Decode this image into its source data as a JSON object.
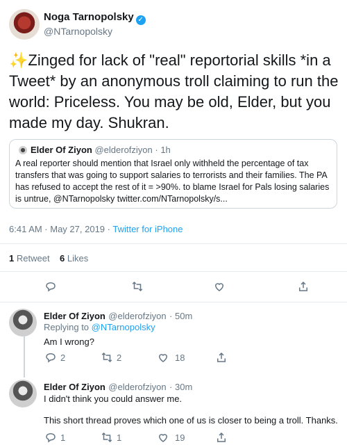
{
  "tweet": {
    "author_name": "Noga Tarnopolsky",
    "author_handle": "@NTarnopolsky",
    "sparkle": "✨",
    "text": "Zinged for lack of \"real\" reportorial skills *in a Tweet* by an anonymous troll claiming to run the world: Priceless. You may be old, Elder, but you made my day. Shukran.",
    "timestamp": "6:41 AM · May 27, 2019 · ",
    "source": "Twitter for iPhone",
    "retweets_count": "1",
    "retweets_label": "Retweet",
    "likes_count": "6",
    "likes_label": "Likes"
  },
  "quoted": {
    "name": "Elder Of Ziyon",
    "handle": "@elderofziyon",
    "time": "· 1h",
    "text": "A real reporter should mention that Israel only withheld the percentage of tax transfers that was going to support salaries to terrorists and their families. The PA has refused to accept the rest of it = >90%. to blame Israel for Pals losing salaries is untrue, @NTarnopolsky twitter.com/NTarnopolsky/s..."
  },
  "replies": [
    {
      "name": "Elder Of Ziyon",
      "handle": "@elderofziyon",
      "time": "· 50m",
      "replying_to_label": "Replying to ",
      "replying_to": "@NTarnopolsky",
      "text": "Am I wrong?",
      "reply_count": "2",
      "retweet_count": "2",
      "like_count": "18"
    },
    {
      "name": "Elder Of Ziyon",
      "handle": "@elderofziyon",
      "time": "· 30m",
      "text_1": "I didn't think you could answer me.",
      "text_2": "This short thread proves which one of us is closer to being a troll. Thanks.",
      "reply_count": "1",
      "retweet_count": "1",
      "like_count": "19"
    }
  ],
  "icons": {
    "reply": "reply-icon",
    "retweet": "retweet-icon",
    "like": "heart-icon",
    "share": "share-icon"
  },
  "colors": {
    "link": "#1da1f2",
    "muted": "#657786",
    "border": "#e6ecf0"
  }
}
